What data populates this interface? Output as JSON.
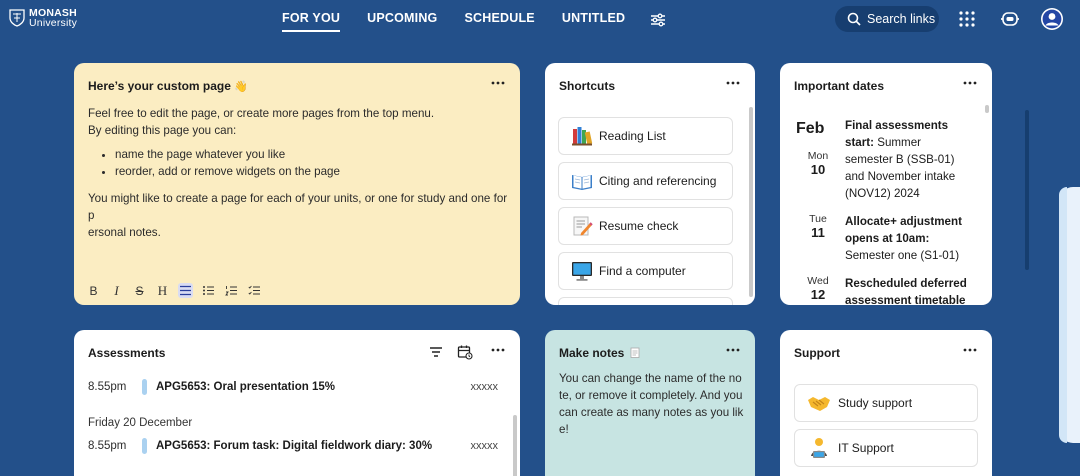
{
  "logo": {
    "line1": "MONASH",
    "line2": "University"
  },
  "nav": {
    "tabs": [
      "FOR YOU",
      "UPCOMING",
      "SCHEDULE",
      "UNTITLED"
    ],
    "active": "FOR YOU"
  },
  "search": {
    "label": "Search links"
  },
  "custom_page": {
    "title": "Here’s your custom page",
    "title_emoji": "👋",
    "intro": "Feel free to edit the page, or create more pages from the top menu.",
    "intro2": "By editing this page you can:",
    "bullets": [
      "name the page whatever you like",
      "reorder, add or remove widgets on the page"
    ],
    "closing_line1": "You might like to create a page for each of your units, or one for study and one for p",
    "closing_line2": "ersonal notes.",
    "toolbar": [
      "B",
      "I",
      "S",
      "H"
    ]
  },
  "shortcuts": {
    "title": "Shortcuts",
    "items": [
      {
        "label": "Reading List",
        "icon": "books-icon"
      },
      {
        "label": "Citing and referencing",
        "icon": "open-book-icon"
      },
      {
        "label": "Resume check",
        "icon": "document-pencil-icon"
      },
      {
        "label": "Find a computer",
        "icon": "computer-icon"
      }
    ]
  },
  "important_dates": {
    "title": "Important dates",
    "month": "Feb",
    "entries": [
      {
        "weekday": "Mon",
        "day": "10",
        "bold": "Final assessments start:",
        "text": " Summer semester B (SSB-01) and November intake (NOV12) 2024"
      },
      {
        "weekday": "Tue",
        "day": "11",
        "bold": "Allocate+ adjustment opens at 10am:",
        "text": " Semester one (S1-01)"
      },
      {
        "weekday": "Wed",
        "day": "12",
        "bold": "Rescheduled deferred assessment timetable",
        "text": ""
      }
    ]
  },
  "assessments": {
    "title": "Assessments",
    "rows": [
      {
        "time": "8.55pm",
        "name": "APG5653: Oral presentation 15%",
        "code": "xxxxx"
      },
      {
        "time": "8.55pm",
        "name": "APG5653: Forum task: Digital fieldwork diary: 30%",
        "code": "xxxxx"
      }
    ],
    "day_label": "Friday 20 December"
  },
  "make_notes": {
    "title": "Make notes",
    "text": "You can change the name of the note, or remove it completely. And you can create as many notes as you like!"
  },
  "support": {
    "title": "Support",
    "items": [
      {
        "label": "Study support",
        "icon": "handshake-icon"
      },
      {
        "label": "IT Support",
        "icon": "it-person-icon"
      }
    ]
  },
  "colors": {
    "background": "#23508a",
    "custom_card": "#fbedc2",
    "notes_card": "#c7e4e2",
    "assessment_bar": "#aad1f0"
  }
}
